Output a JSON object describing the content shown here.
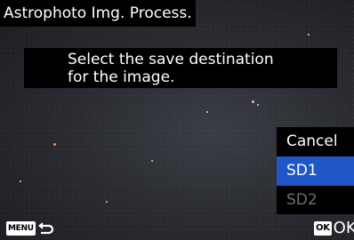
{
  "header": {
    "title": "Astrophoto Img. Process."
  },
  "dialog": {
    "message_line1": "Select the save destination",
    "message_line2": "for the image."
  },
  "menu": {
    "items": [
      {
        "label": "Cancel",
        "state": "normal"
      },
      {
        "label": "SD1",
        "state": "selected"
      },
      {
        "label": "SD2",
        "state": "disabled"
      }
    ]
  },
  "footer": {
    "menu_badge": "MENU",
    "back_icon": "return-arrow-icon",
    "ok_badge": "OK",
    "ok_label": "OK"
  },
  "colors": {
    "selection": "#1f57c9",
    "disabled_text": "#6f6f6f",
    "panel": "#000000"
  }
}
